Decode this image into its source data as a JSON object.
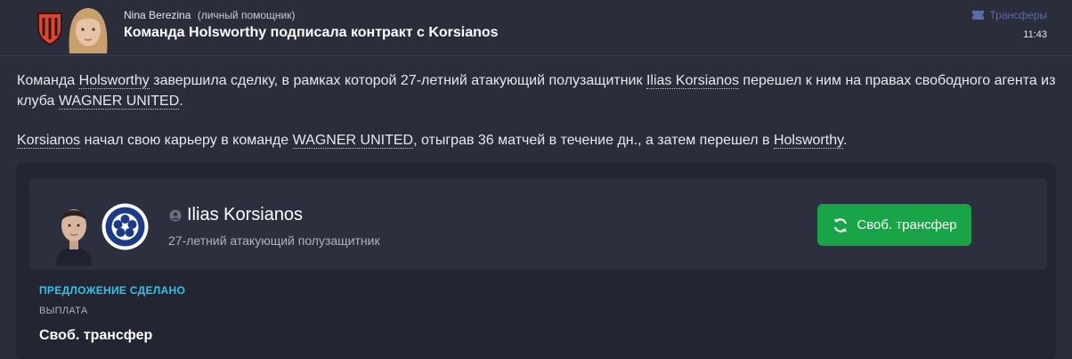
{
  "header": {
    "sender_name": "Nina Berezina",
    "sender_role": "(личный помощник)",
    "subject": "Команда Holsworthy подписала контракт с Korsianos",
    "category": "Трансферы",
    "time": "11:43"
  },
  "body": {
    "p1": [
      "Команда ",
      "Holsworthy",
      " завершила сделку, в рамках которой 27-летний атакующий полузащитник ",
      "Ilias Korsianos",
      " перешел к ним на правах свободного агента из клуба ",
      "WAGNER UNITED",
      "."
    ],
    "p2": [
      "Korsianos",
      " начал свою карьеру в команде ",
      "WAGNER UNITED",
      ", отыграв 36 матчей в течение дн., а затем перешел в ",
      "Holsworthy",
      "."
    ]
  },
  "card": {
    "player_name": "Ilias Korsianos",
    "player_desc": "27-летний атакующий полузащитник",
    "transfer_button": "Своб. трансфер"
  },
  "offer": {
    "heading": "ПРЕДЛОЖЕНИЕ СДЕЛАНО",
    "payment_label": "ВЫПЛАТА",
    "payment_value": "Своб. трансфер"
  },
  "icons": {
    "category": "ticket-icon",
    "transfer": "refresh-icon",
    "player": "person-icon"
  },
  "colors": {
    "background": "#2b2d3b",
    "accent_cyan": "#2ec4e8",
    "button_green": "#1aa448",
    "category_blue": "#5b6aa8",
    "club_orange": "#e0452c"
  }
}
